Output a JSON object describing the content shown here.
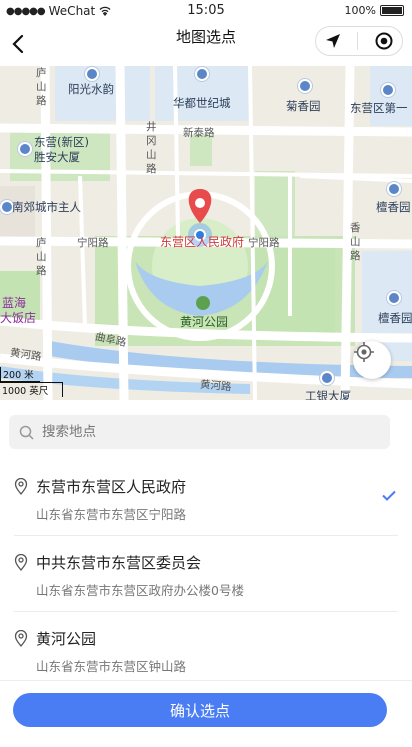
{
  "status_bar": {
    "carrier": "WeChat",
    "time": "15:05",
    "battery": "100%"
  },
  "nav": {
    "title": "地图选点"
  },
  "map": {
    "labels": {
      "yangguang": "阳光水韵",
      "huadu": "华都世纪城",
      "juxiang": "菊香园",
      "dongying_first": "东营区第一",
      "dongying_xinqu": "东营(新区)",
      "shengan": "胜安大厦",
      "nanjiao": "南郊城市主人",
      "tanxiang1": "檀香园",
      "tanxiang2": "檀香园",
      "lanhai1": "蓝海",
      "lanhai2": "大饭店",
      "gov": "东营区人民政府",
      "huanghe_park": "黄河公园",
      "icbc": "工银大厦",
      "ninyang1": "宁阳路",
      "ninyang2": "宁阳路",
      "xintai": "新泰路",
      "jinggang": "井冈山路",
      "lushan1": "庐山路",
      "lushan2": "庐山路",
      "xiangshan": "香山路",
      "qufu": "曲阜路",
      "huanghe1": "黄河路",
      "huanghe2": "黄河路"
    },
    "scale": {
      "small": "200 米",
      "large": "1000 英尺"
    }
  },
  "search": {
    "placeholder": "搜索地点"
  },
  "results": [
    {
      "name": "东营市东营区人民政府",
      "address": "山东省东营市东营区宁阳路",
      "selected": true
    },
    {
      "name": "中共东营市东营区委员会",
      "address": "山东省东营市东营区政府办公楼0号楼",
      "selected": false
    },
    {
      "name": "黄河公园",
      "address": "山东省东营市东营区钟山路",
      "selected": false
    }
  ],
  "confirm_label": "确认选点",
  "colors": {
    "accent": "#4a7cf3",
    "marker": "#e84b4b",
    "park": "#c8e6b8",
    "water": "#a8cbef"
  }
}
